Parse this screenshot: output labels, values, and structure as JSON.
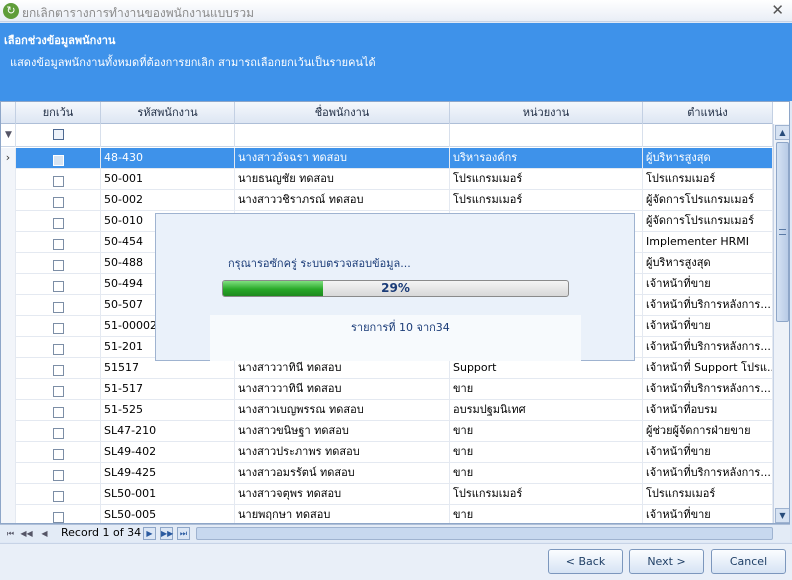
{
  "window": {
    "title": "ยกเลิกตารางการทำงานของพนักงานแบบรวม",
    "close_glyph": "✕",
    "icon": "app-refresh-icon"
  },
  "header": {
    "title": "เลือกช่วงข้อมูลพนักงาน",
    "description": "แสดงข้อมูลพนักงานทั้งหมดที่ต้องการยกเลิก สามารถเลือกยกเว้นเป็นรายคนได้"
  },
  "grid": {
    "columns": [
      "ยกเว้น",
      "รหัสพนักงาน",
      "ชื่อพนักงาน",
      "หน่วยงาน",
      "ตำแหน่ง"
    ],
    "rows": [
      {
        "code": "48-430",
        "name": "นางสาวอัจฉรา ทดสอบ",
        "dept": "บริหารองค์กร",
        "position": "ผู้บริหารสูงสุด",
        "selected": true
      },
      {
        "code": "50-001",
        "name": "นายธนญชัย ทดสอบ",
        "dept": "โปรแกรมเมอร์",
        "position": "โปรแกรมเมอร์"
      },
      {
        "code": "50-002",
        "name": "นางสาววชิราภรณ์ ทดสอบ",
        "dept": "โปรแกรมเมอร์",
        "position": "ผู้จัดการโปรแกรมเมอร์"
      },
      {
        "code": "50-010",
        "name": "",
        "dept": "",
        "position": "ผู้จัดการโปรแกรมเมอร์"
      },
      {
        "code": "50-454",
        "name": "",
        "dept": "",
        "position": "Implementer HRMI"
      },
      {
        "code": "50-488",
        "name": "",
        "dept": "",
        "position": "ผู้บริหารสูงสุด"
      },
      {
        "code": "50-494",
        "name": "",
        "dept": "",
        "position": "เจ้าหน้าที่ขาย"
      },
      {
        "code": "50-507",
        "name": "",
        "dept": "",
        "position": "เจ้าหน้าที่บริการหลังการ..."
      },
      {
        "code": "51-00002",
        "name": "",
        "dept": "",
        "position": "เจ้าหน้าที่ขาย"
      },
      {
        "code": "51-201",
        "name": "",
        "dept": "",
        "position": "เจ้าหน้าที่บริการหลังการ..."
      },
      {
        "code": "51517",
        "name": "นางสาววาทินี ทดสอบ",
        "dept": "Support",
        "position": "เจ้าหน้าที่ Support โปรแ..."
      },
      {
        "code": "51-517",
        "name": "นางสาววาทินี ทดสอบ",
        "dept": "ขาย",
        "position": "เจ้าหน้าที่บริการหลังการ..."
      },
      {
        "code": "51-525",
        "name": "นางสาวเบญพรรณ ทดสอบ",
        "dept": "อบรมปฐมนิเทศ",
        "position": "เจ้าหน้าที่อบรม"
      },
      {
        "code": "SL47-210",
        "name": "นางสาวขนิษฐา ทดสอบ",
        "dept": "ขาย",
        "position": "ผู้ช่วยผู้จัดการฝ่ายขาย"
      },
      {
        "code": "SL49-402",
        "name": "นางสาวประภาพร ทดสอบ",
        "dept": "ขาย",
        "position": "เจ้าหน้าที่ขาย"
      },
      {
        "code": "SL49-425",
        "name": "นางสาวอมรรัตน์ ทดสอบ",
        "dept": "ขาย",
        "position": "เจ้าหน้าที่บริการหลังการ..."
      },
      {
        "code": "SL50-001",
        "name": "นางสาวจตุพร ทดสอบ",
        "dept": "โปรแกรมเมอร์",
        "position": "โปรแกรมเมอร์"
      },
      {
        "code": "SL50-005",
        "name": "นายพฤกษา ทดสอบ",
        "dept": "ขาย",
        "position": "เจ้าหน้าที่ขาย"
      }
    ],
    "row_indicator": "›",
    "filter_icon": "funnel-icon"
  },
  "navigator": {
    "record_text": "Record 1 of 34"
  },
  "progress_dialog": {
    "message": "กรุณารอซักครู่ ระบบตรวจสอบข้อมูล...",
    "percent_value": 0.29,
    "percent_label": "29%",
    "count_text": "รายการที่ 10 จาก34"
  },
  "buttons": {
    "back": "< Back",
    "next": "Next >",
    "cancel": "Cancel"
  },
  "colors": {
    "header_blue": "#3e92ea",
    "selected_row": "#3e92ea",
    "progress_green": "#28a828"
  }
}
